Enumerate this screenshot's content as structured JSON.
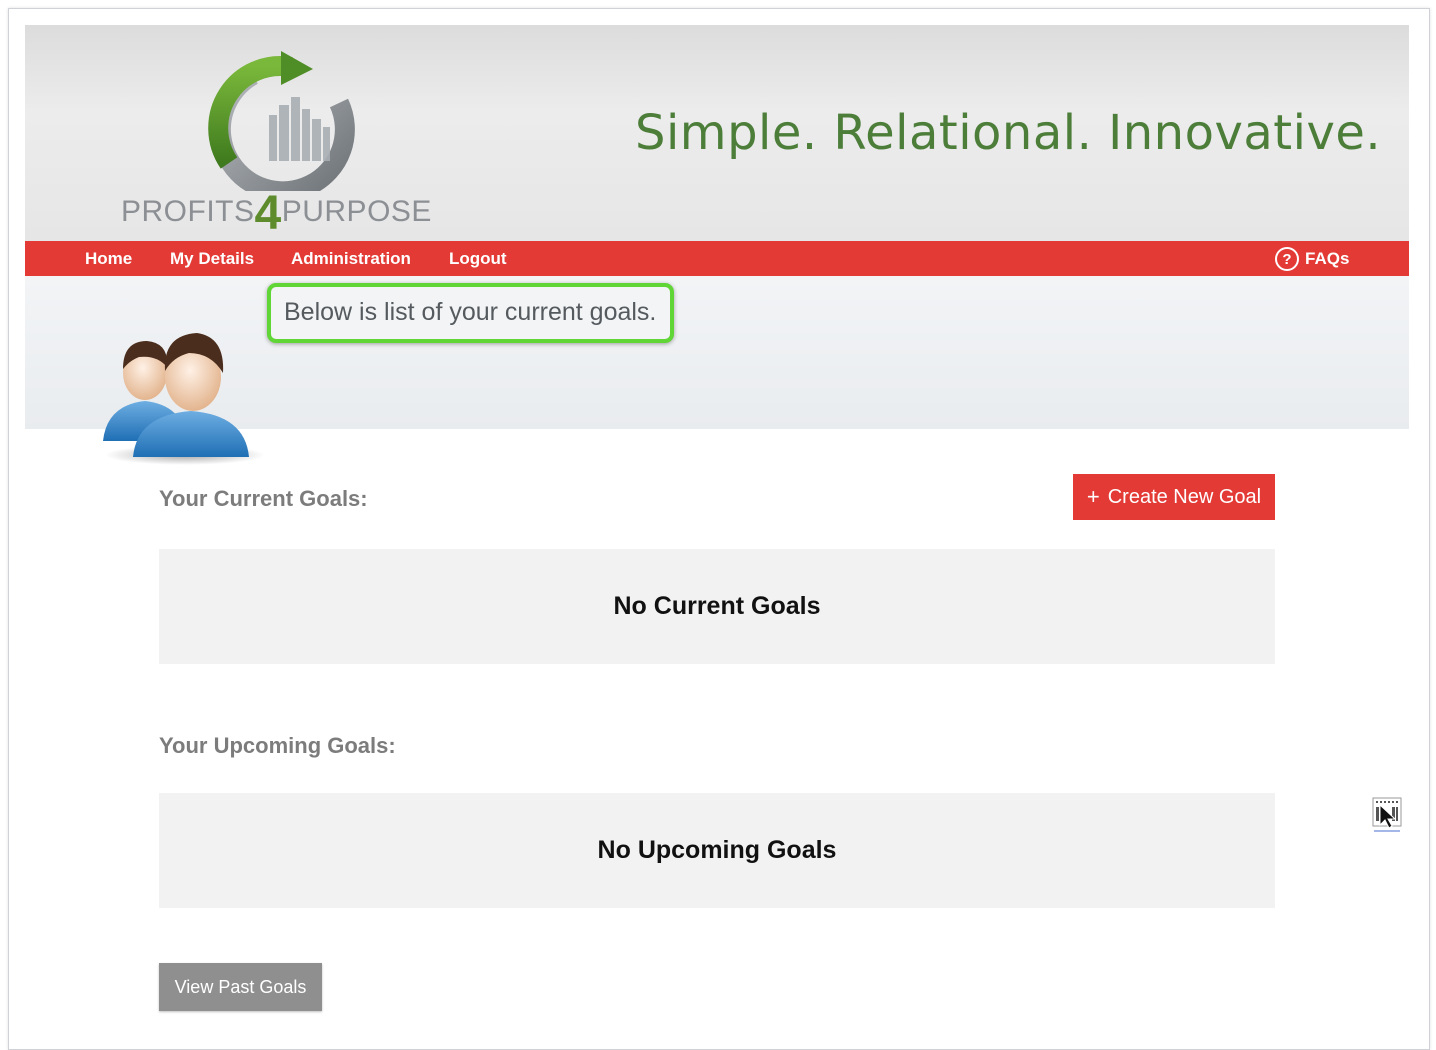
{
  "brand": {
    "logo_text_left": "PROFITS",
    "logo_text_digit": "4",
    "logo_text_right": "PURPOSE",
    "tagline": "Simple. Relational. Innovative.",
    "colors": {
      "green": "#5e8c2c",
      "grey": "#8c9095",
      "red": "#e33a36"
    }
  },
  "nav": {
    "items": [
      {
        "label": "Home"
      },
      {
        "label": "My Details"
      },
      {
        "label": "Administration"
      },
      {
        "label": "Logout"
      }
    ],
    "faq_icon": "question-circle-icon",
    "faq_icon_glyph": "?",
    "faq_label": "FAQs"
  },
  "banner": {
    "callout_text": "Below is list of your current goals.",
    "callout_border_color": "#5fd636",
    "icon": "users-icon"
  },
  "current": {
    "title": "Your Current Goals:",
    "create_button_icon_glyph": "+",
    "create_button_label": "Create New Goal",
    "empty_text": "No Current Goals"
  },
  "upcoming": {
    "title": "Your Upcoming Goals:",
    "empty_text": "No Upcoming Goals"
  },
  "past": {
    "button_label": "View Past Goals"
  }
}
